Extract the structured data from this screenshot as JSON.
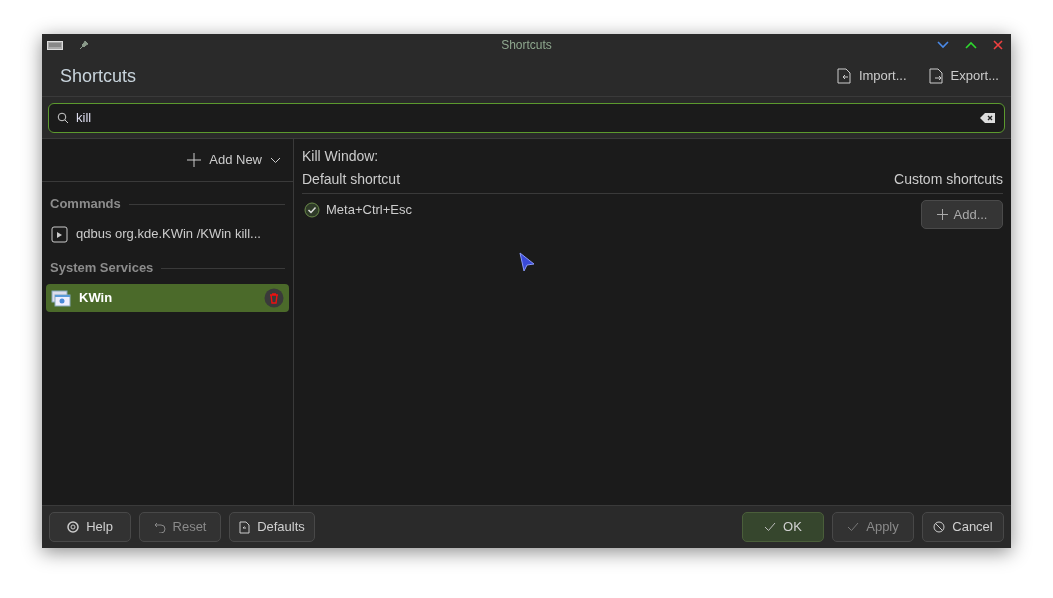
{
  "window": {
    "title": "Shortcuts"
  },
  "header": {
    "title": "Shortcuts",
    "actions": [
      {
        "label": "Import...",
        "kind": "import"
      },
      {
        "label": "Export...",
        "kind": "export"
      }
    ]
  },
  "search": {
    "value": "kill"
  },
  "sidebar": {
    "add_new": "Add New",
    "groups": [
      {
        "title": "Commands",
        "items": [
          {
            "label": "qdbus org.kde.KWin /KWin kill...",
            "kind": "command",
            "selected": false
          }
        ]
      },
      {
        "title": "System Services",
        "items": [
          {
            "label": "KWin",
            "kind": "service",
            "selected": true
          }
        ]
      }
    ]
  },
  "detail": {
    "title": "Kill Window:",
    "default_header": "Default shortcut",
    "custom_header": "Custom shortcuts",
    "default_shortcut": {
      "label": "Meta+Ctrl+Esc",
      "checked": true
    },
    "add_button": "Add..."
  },
  "footer": {
    "left": [
      {
        "label": "Help",
        "kind": "help",
        "disabled": false
      },
      {
        "label": "Reset",
        "kind": "reset",
        "disabled": true
      },
      {
        "label": "Defaults",
        "kind": "defaults",
        "disabled": false
      }
    ],
    "right": [
      {
        "label": "OK",
        "kind": "ok",
        "disabled": false
      },
      {
        "label": "Apply",
        "kind": "apply",
        "disabled": true
      },
      {
        "label": "Cancel",
        "kind": "cancel",
        "disabled": false
      }
    ]
  }
}
